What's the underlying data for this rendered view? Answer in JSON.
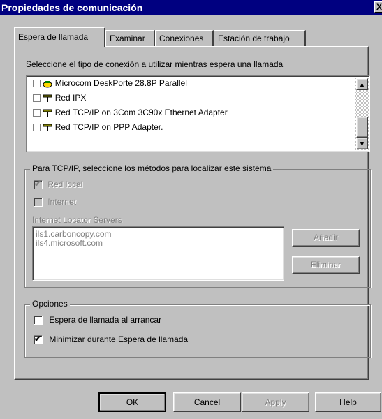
{
  "window": {
    "title": "Propiedades de comunicación",
    "close_glyph": "X"
  },
  "tabs": [
    {
      "label": "Espera de llamada",
      "active": true
    },
    {
      "label": "Examinar",
      "active": false
    },
    {
      "label": "Conexiones",
      "active": false
    },
    {
      "label": "Estación de trabajo",
      "active": false
    }
  ],
  "connection": {
    "prompt": "Seleccione el tipo de conexión a utilizar mientras espera una llamada",
    "items": [
      {
        "label": "Microcom DeskPorte 28.8P Parallel",
        "icon": "modem-icon",
        "checked": false
      },
      {
        "label": "Red IPX",
        "icon": "network-icon",
        "checked": false
      },
      {
        "label": "Red TCP/IP on 3Com 3C90x Ethernet Adapter",
        "icon": "network-icon",
        "checked": false
      },
      {
        "label": "Red TCP/IP on PPP Adapter.",
        "icon": "network-icon",
        "checked": false
      }
    ]
  },
  "tcpip": {
    "group_label": "Para TCP/IP, seleccione los métodos para localizar este sistema",
    "red_local": {
      "label": "Red local",
      "checked": true,
      "enabled": false
    },
    "internet": {
      "label": "Internet",
      "checked": false,
      "enabled": false
    },
    "servers_label": "Internet Locator Servers",
    "servers": [
      "ils1.carboncopy.com",
      "ils4.microsoft.com"
    ],
    "add_button": "Añadir",
    "remove_button": "Eliminar"
  },
  "options": {
    "group_label": "Opciones",
    "startup": {
      "label": "Espera de llamada al arrancar",
      "checked": false
    },
    "minimize": {
      "label": "Minimizar durante Espera de llamada",
      "checked": true
    }
  },
  "buttons": {
    "ok": "OK",
    "cancel": "Cancel",
    "apply": "Apply",
    "help": "Help"
  },
  "colors": {
    "titlebar": "#000080",
    "face": "#c0c0c0",
    "disabled_text": "#808080"
  }
}
